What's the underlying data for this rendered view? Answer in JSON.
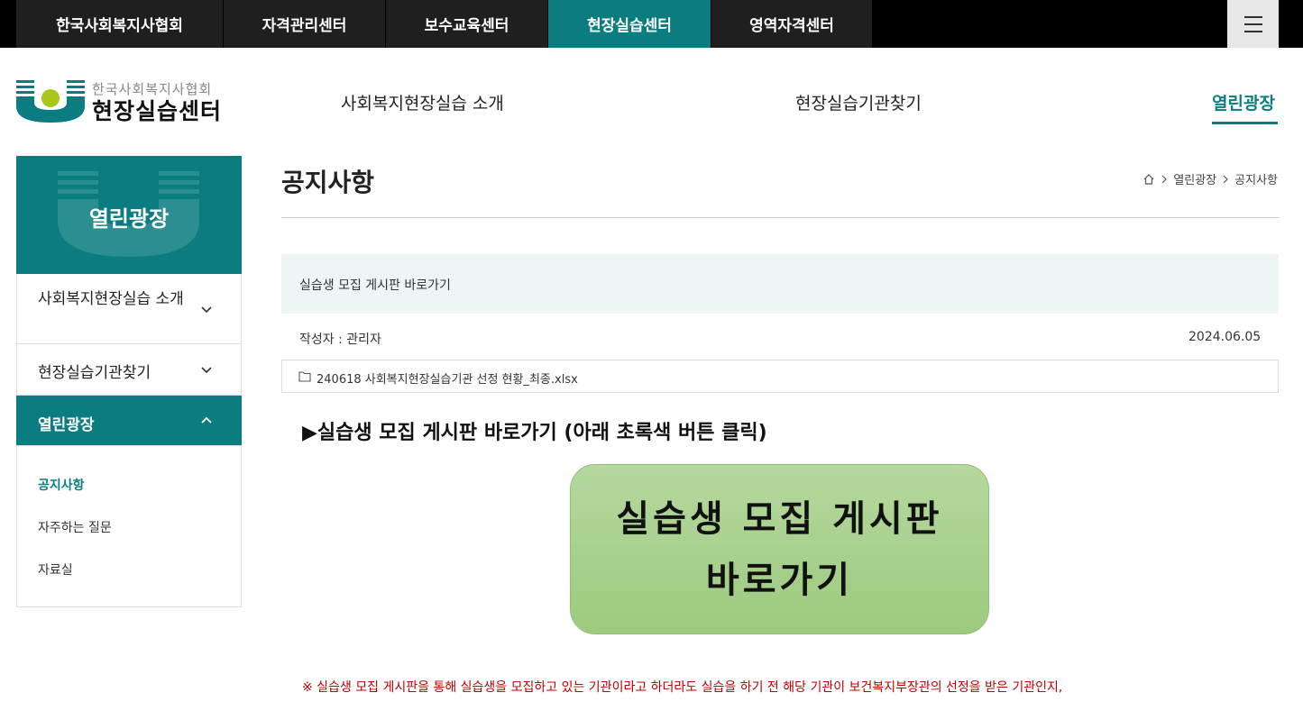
{
  "topnav": {
    "items": [
      "한국사회복지사협회",
      "자격관리센터",
      "보수교육센터",
      "현장실습센터",
      "영역자격센터"
    ],
    "active_index": 3
  },
  "logo": {
    "small_text": "한국사회복지사협회",
    "big_text": "현장실습센터"
  },
  "gnb": {
    "items": [
      "사회복지현장실습 소개",
      "현장실습기관찾기",
      "열린광장"
    ],
    "active_index": 2
  },
  "sidebar": {
    "title": "열린광장",
    "items": [
      {
        "label": "사회복지현장실습 소개"
      },
      {
        "label": "현장실습기관찾기"
      },
      {
        "label": "열린광장"
      }
    ],
    "sub_items": [
      "공지사항",
      "자주하는 질문",
      "자료실"
    ],
    "active_sub_index": 0
  },
  "page": {
    "title": "공지사항",
    "breadcrumb": [
      "열린광장",
      "공지사항"
    ]
  },
  "post": {
    "title": "실습생 모집 게시판 바로가기",
    "author": "작성자 : 관리자",
    "date": "2024.06.05",
    "attachment": "240618 사회복지현장실습기관 선정 현황_최종.xlsx",
    "heading": "▶실습생 모집 게시판 바로가기 (아래 초록색 버튼 클릭)",
    "button_line1": "실습생 모집 게시판",
    "button_line2": "바로가기",
    "notice": "※ 실습생 모집 게시판을 통해 실습생을 모집하고 있는 기관이라고 하더라도 실습을 하기 전 해당 기관이 보건복지부장관의 선정을 받은 기관인지,"
  },
  "colors": {
    "brand": "#0b7d80",
    "button_green": "#a8d190",
    "notice_red": "#c00000"
  },
  "icons": [
    "menu-icon",
    "home-icon",
    "chevron-down-icon",
    "chevron-up-icon",
    "folder-icon",
    "chevron-right-icon"
  ]
}
